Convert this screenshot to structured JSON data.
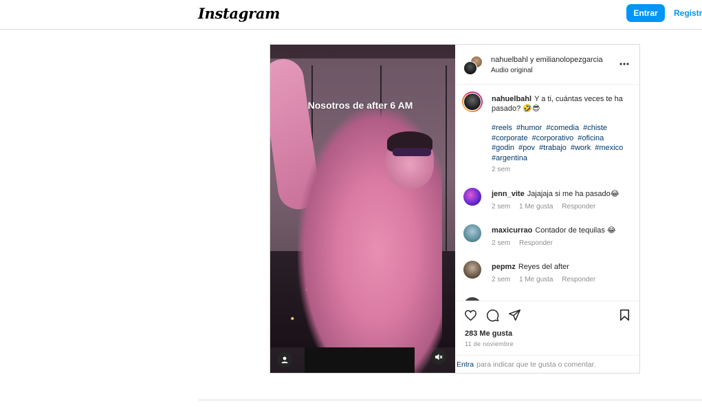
{
  "header": {
    "logo": "Instagram",
    "login_button": "Entrar",
    "register_link": "Registra"
  },
  "post": {
    "video_caption": "Nosotros de after 6 AM",
    "authors": "nahuelbahl y emilianolopezgarcia",
    "audio": "Audio original",
    "caption": {
      "user": "nahuelbahl",
      "text": "Y a ti, cuántas veces te ha pasado? 🤣😎",
      "hashtags": [
        "#reels",
        "#humor",
        "#comedia",
        "#chiste",
        "#corporate",
        "#corporativo",
        "#oficina",
        "#godin",
        "#pov",
        "#trabajo",
        "#work",
        "#mexico",
        "#argentina"
      ],
      "time": "2 sem"
    },
    "comments": [
      {
        "user": "jenn_vite",
        "text": "Jajajaja si me ha pasado😂",
        "time": "2 sem",
        "likes": "1 Me gusta",
        "reply": "Responder"
      },
      {
        "user": "maxicurrao",
        "text": "Contador de tequilas 😂",
        "time": "2 sem",
        "likes": "",
        "reply": "Responder"
      },
      {
        "user": "pepmz",
        "text": "Reyes del after",
        "time": "2 sem",
        "likes": "1 Me gusta",
        "reply": "Responder"
      }
    ],
    "likes_count": "283 Me gusta",
    "date": "11 de noviembre",
    "login_prompt": {
      "link": "Entra",
      "text": "para indicar que te gusta o comentar."
    }
  },
  "icons": [
    "user-icon",
    "mute-icon",
    "more-icon",
    "heart-icon",
    "comment-icon",
    "share-icon",
    "bookmark-icon"
  ],
  "colors": {
    "accent": "#0095f6",
    "link": "#00376b",
    "muted": "#8e8e8e"
  }
}
